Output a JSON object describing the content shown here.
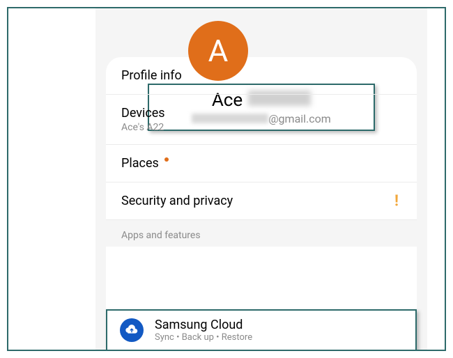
{
  "avatar_letter": "A",
  "profile": {
    "name_first": "Ace",
    "email_suffix": "@gmail.com"
  },
  "items": {
    "profile_info": {
      "title": "Profile info"
    },
    "devices": {
      "title": "Devices",
      "sub": "Ace's A22"
    },
    "places": {
      "title": "Places"
    },
    "security": {
      "title": "Security and privacy"
    }
  },
  "section_header": "Apps and features",
  "samsung_cloud": {
    "title": "Samsung Cloud",
    "sub": "Sync  •  Back up  •  Restore"
  }
}
